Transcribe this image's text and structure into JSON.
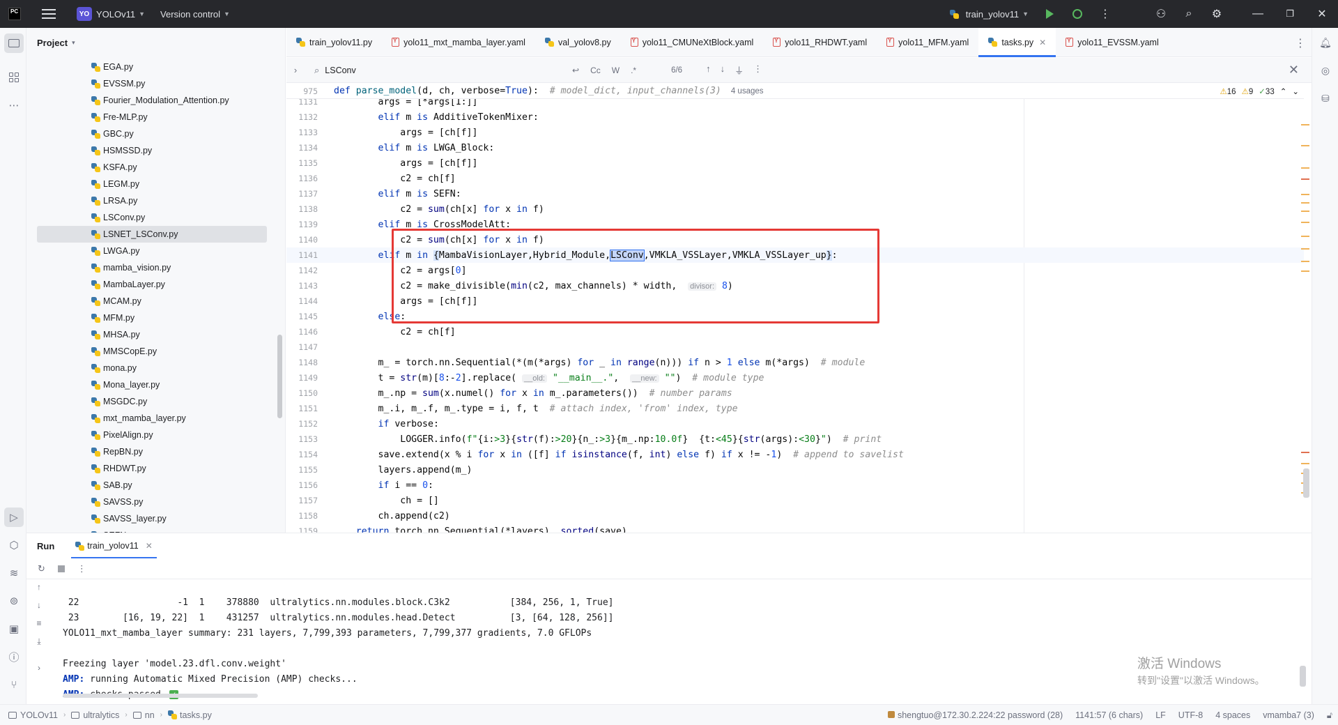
{
  "titlebar": {
    "logo_text": "PC",
    "project_badge": "YO",
    "project_name": "YOLOv11",
    "vcs_label": "Version control",
    "run_config": "train_yolov11"
  },
  "project_panel": {
    "title": "Project",
    "files": [
      "EGA.py",
      "EVSSM.py",
      "Fourier_Modulation_Attention.py",
      "Fre-MLP.py",
      "GBC.py",
      "HSMSSD.py",
      "KSFA.py",
      "LEGM.py",
      "LRSA.py",
      "LSConv.py",
      "LSNET_LSConv.py",
      "LWGA.py",
      "mamba_vision.py",
      "MambaLayer.py",
      "MCAM.py",
      "MFM.py",
      "MHSA.py",
      "MMSCopE.py",
      "mona.py",
      "Mona_layer.py",
      "MSGDC.py",
      "mxt_mamba_layer.py",
      "PixelAlign.py",
      "RepBN.py",
      "RHDWT.py",
      "SAB.py",
      "SAVSS.py",
      "SAVSS_layer.py",
      "SEFN.py"
    ],
    "selected_file": "LSNET_LSConv.py"
  },
  "tabs": [
    {
      "label": "train_yolov11.py",
      "type": "py"
    },
    {
      "label": "yolo11_mxt_mamba_layer.yaml",
      "type": "yaml"
    },
    {
      "label": "val_yolov8.py",
      "type": "py"
    },
    {
      "label": "yolo11_CMUNeXtBlock.yaml",
      "type": "yaml"
    },
    {
      "label": "yolo11_RHDWT.yaml",
      "type": "yaml"
    },
    {
      "label": "yolo11_MFM.yaml",
      "type": "yaml"
    },
    {
      "label": "tasks.py",
      "type": "py",
      "active": true
    },
    {
      "label": "yolo11_EVSSM.yaml",
      "type": "yaml"
    }
  ],
  "search": {
    "query": "LSConv",
    "opt_case": "Cc",
    "opt_word": "W",
    "opt_regex": ".*",
    "match_count": "6/6"
  },
  "editor": {
    "sticky": {
      "line_no": "975",
      "usages": "4 usages"
    },
    "inspections": {
      "warnings": "16",
      "weak_warnings": "9",
      "typos": "33"
    },
    "line_numbers": [
      "1131",
      "1132",
      "1133",
      "1134",
      "1135",
      "1136",
      "1137",
      "1138",
      "1139",
      "1140",
      "1141",
      "1142",
      "1143",
      "1144",
      "1145",
      "1146",
      "1147",
      "1148",
      "1149",
      "1150",
      "1151",
      "1152",
      "1153",
      "1154",
      "1155",
      "1156",
      "1157",
      "1158",
      "1159"
    ],
    "current_line": "1141"
  },
  "run_panel": {
    "title": "Run",
    "tab_label": "train_yolov11",
    "console": [
      " 22                  -1  1    378880  ultralytics.nn.modules.block.C3k2           [384, 256, 1, True]",
      " 23        [16, 19, 22]  1    431257  ultralytics.nn.modules.head.Detect          [3, [64, 128, 256]]",
      "YOLO11_mxt_mamba_layer summary: 231 layers, 7,799,393 parameters, 7,799,377 gradients, 7.0 GFLOPs",
      "",
      "Freezing layer 'model.23.dfl.conv.weight'"
    ],
    "amp_label": "AMP:",
    "amp_line1": " running Automatic Mixed Precision (AMP) checks...",
    "amp_line2": " checks passed ",
    "watermark_title": "激活 Windows",
    "watermark_sub": "转到\"设置\"以激活 Windows。"
  },
  "statusbar": {
    "breadcrumbs": [
      "YOLOv11",
      "ultralytics",
      "nn",
      "tasks.py"
    ],
    "remote": "shengtuo@172.30.2.224:22 password (28)",
    "position": "1141:57 (6 chars)",
    "line_sep": "LF",
    "encoding": "UTF-8",
    "indent": "4 spaces",
    "interpreter": "vmamba7 (3)"
  },
  "colors": {
    "accent": "#3574f0",
    "highlight_box": "#e53935",
    "run_green": "#58b85f"
  }
}
